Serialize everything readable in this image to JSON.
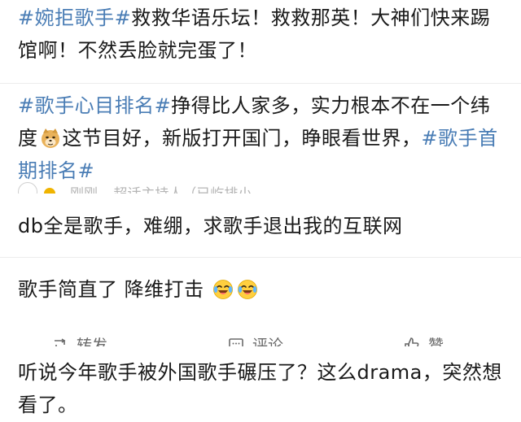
{
  "posts": [
    {
      "segments": [
        {
          "type": "tag",
          "text": "#婉拒歌手#"
        },
        {
          "type": "text",
          "text": "救救华语乐坛！救救那英！大神们快来踢馆啊！不然丢脸就完蛋了！"
        }
      ]
    },
    {
      "segments": [
        {
          "type": "tag",
          "text": "#歌手心目排名#"
        },
        {
          "type": "text",
          "text": "挣得比人家多，实力根本不在一个纬度"
        },
        {
          "type": "emoji",
          "name": "doge-emoji"
        },
        {
          "type": "text",
          "text": "这节目好，新版打开国门，睁眼看世界，"
        },
        {
          "type": "tag",
          "text": "#歌手首期排名#"
        }
      ]
    }
  ],
  "clipped_meta": {
    "username": "刚刚",
    "text": "超话主持人（已屹排小..."
  },
  "comments": [
    {
      "text": "db全是歌手，难绷，求歌手退出我的互联网"
    },
    {
      "text": "歌手简直了 降维打击",
      "emojis": [
        "laugh-cry-emoji",
        "laugh-cry-emoji"
      ]
    }
  ],
  "actions": {
    "repost_label": "转发",
    "comment_label": "评论",
    "like_label": "赞"
  },
  "last_post": {
    "text": "听说今年歌手被外国歌手碾压了？这么drama，突然想看了。"
  },
  "colors": {
    "topic": "#4a7db5",
    "text": "#1a1a1a",
    "muted": "#6a6a6a",
    "divider": "#ececec"
  }
}
